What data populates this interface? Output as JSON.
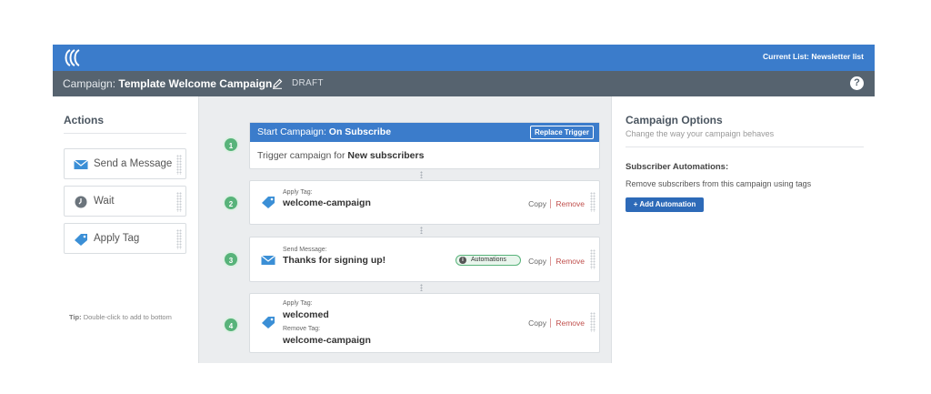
{
  "header": {
    "current_list_label": "Current List:",
    "current_list_value": "Newsletter list"
  },
  "titlebar": {
    "campaign_label": "Campaign:",
    "campaign_name": "Template Welcome Campaign",
    "status": "DRAFT",
    "help": "?"
  },
  "actions": {
    "title": "Actions",
    "items": [
      {
        "label": "Send a Message",
        "icon": "envelope-icon"
      },
      {
        "label": "Wait",
        "icon": "clock-icon"
      },
      {
        "label": "Apply Tag",
        "icon": "tag-icon"
      }
    ],
    "tip_prefix": "Tip:",
    "tip_text": "Double-click to add to bottom"
  },
  "flow": {
    "start": {
      "number": "1",
      "head_prefix": "Start Campaign:",
      "head_value": "On Subscribe",
      "replace_label": "Replace Trigger",
      "body_prefix": "Trigger campaign for",
      "body_value": "New subscribers"
    },
    "steps": [
      {
        "number": "2",
        "label1": "Apply Tag:",
        "value1": "welcome-campaign",
        "copy": "Copy",
        "remove": "Remove"
      },
      {
        "number": "3",
        "label1": "Send Message:",
        "value1": "Thanks for signing up!",
        "badge": "Automations",
        "badge_icon": "i",
        "copy": "Copy",
        "remove": "Remove"
      },
      {
        "number": "4",
        "label1": "Apply Tag:",
        "value1": "welcomed",
        "label2": "Remove Tag:",
        "value2": "welcome-campaign",
        "copy": "Copy",
        "remove": "Remove"
      }
    ]
  },
  "options": {
    "title": "Campaign Options",
    "subtitle": "Change the way your campaign behaves",
    "section_title": "Subscriber Automations:",
    "section_desc": "Remove subscribers from this campaign using tags",
    "add_button": "+ Add Automation"
  },
  "colors": {
    "topbar": "#3b7ccb",
    "titlebar": "#56636f",
    "step_green": "#58b37a",
    "remove_red": "#c0504d"
  }
}
